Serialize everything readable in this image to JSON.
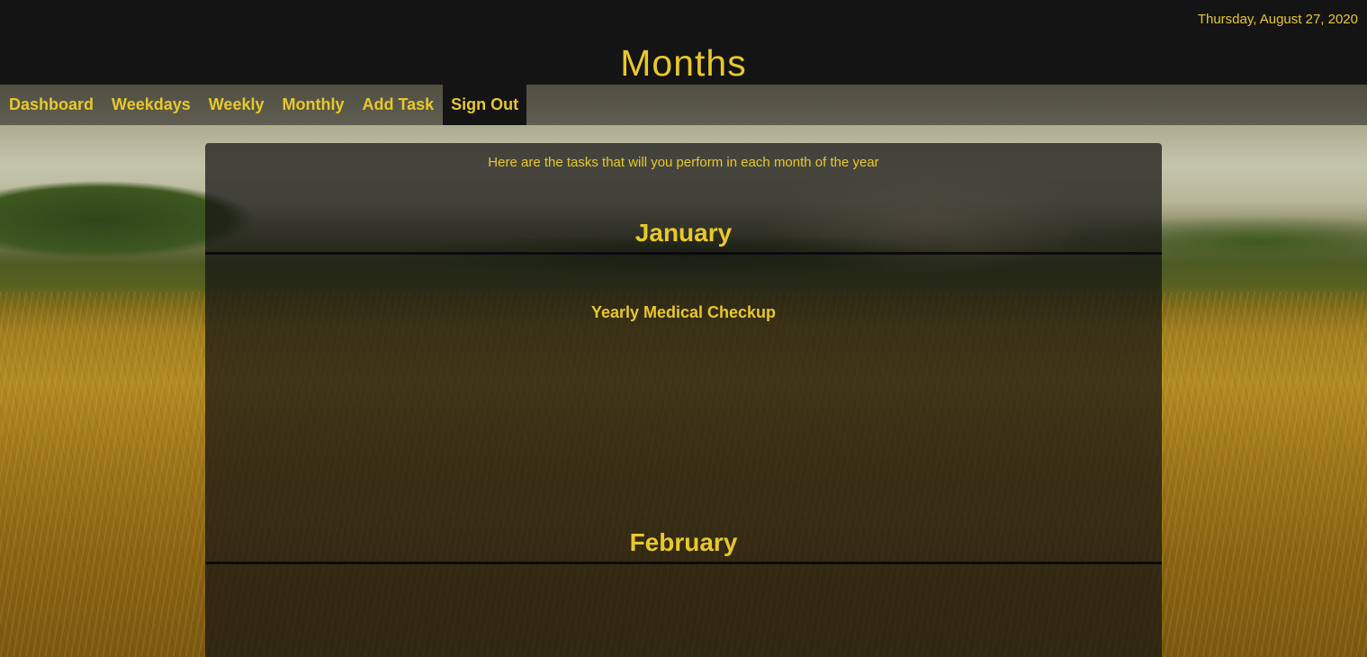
{
  "header": {
    "date": "Thursday, August 27, 2020",
    "title": "Months"
  },
  "nav": {
    "items": [
      {
        "label": "Dashboard"
      },
      {
        "label": "Weekdays"
      },
      {
        "label": "Weekly"
      },
      {
        "label": "Monthly"
      },
      {
        "label": "Add Task"
      },
      {
        "label": "Sign Out"
      }
    ],
    "active": "Sign Out"
  },
  "main": {
    "intro": "Here are the tasks that will you perform in each month of the year",
    "months": [
      {
        "name": "January",
        "tasks": [
          "Yearly Medical Checkup"
        ]
      },
      {
        "name": "February",
        "tasks": []
      }
    ]
  },
  "colors": {
    "accent": "#e8c82a",
    "header_bg": "#141414"
  }
}
